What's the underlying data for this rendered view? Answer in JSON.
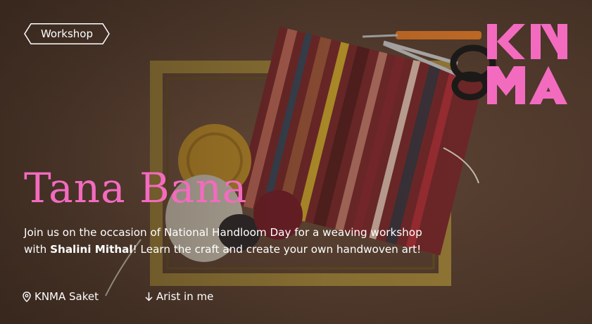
{
  "tag": {
    "label": "Workshop"
  },
  "event": {
    "title": "Tana Bana",
    "description_pre": "Join us on the occasion of National Handloom Day for a weaving workshop with ",
    "artist_name": "Shalini Mithal",
    "description_post": "! Learn the craft and create your own handwoven art!"
  },
  "meta": {
    "location": "KNMA Saket",
    "link": "Arist in me"
  },
  "logo": {
    "text": "KNMA"
  },
  "icons": {
    "location": "map-pin-icon",
    "link": "arrow-down-icon"
  },
  "colors": {
    "accent": "#f36bbf",
    "text": "#ffffff",
    "background": "#5e4434"
  }
}
